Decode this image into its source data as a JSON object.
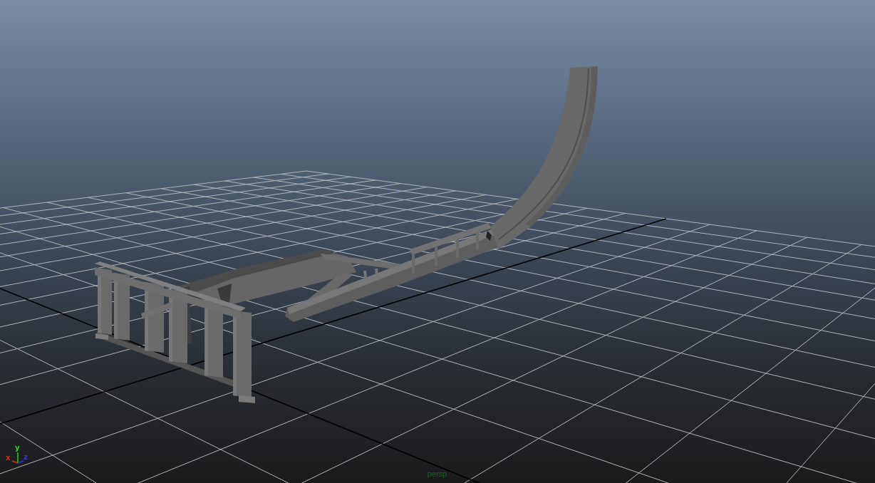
{
  "viewport": {
    "axis_gizmo": [
      {
        "label": "x",
        "color": "#d42a2a"
      },
      {
        "label": "y",
        "color": "#2bd42b"
      },
      {
        "label": "z",
        "color": "#2a3ae0"
      }
    ],
    "camera_label": "persp"
  }
}
